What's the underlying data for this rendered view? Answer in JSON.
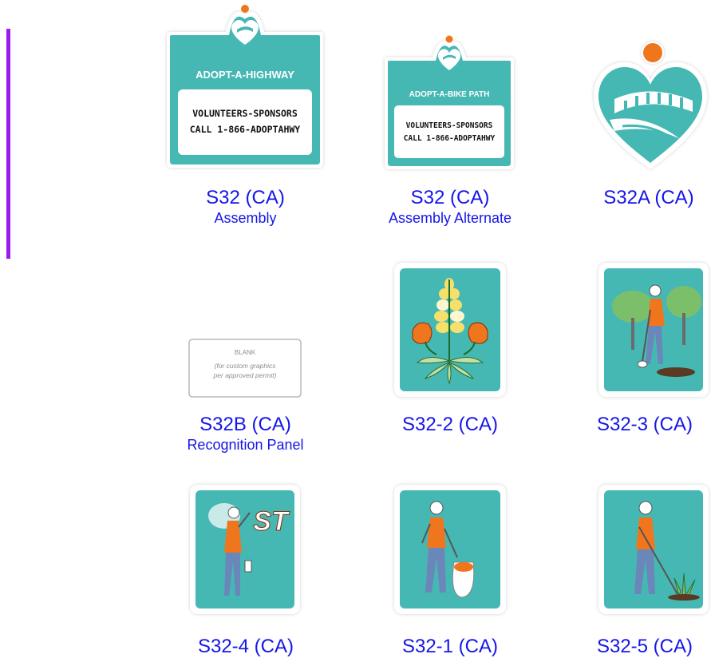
{
  "colors": {
    "teal": "#45b8b4",
    "orange": "#f0761e",
    "link_blue": "#1515ea",
    "purple_bar": "#9b1ee8"
  },
  "signs": [
    {
      "code": "S32 (CA)",
      "subtitle": "Assembly",
      "header": "ADOPT-A-HIGHWAY",
      "panel_line1": "VOLUNTEERS-SPONSORS",
      "panel_line2": "CALL 1-866-ADOPTAHWY"
    },
    {
      "code": "S32 (CA)",
      "subtitle": "Assembly Alternate",
      "header": "ADOPT-A-BIKE PATH",
      "panel_line1": "VOLUNTEERS-SPONSORS",
      "panel_line2": "CALL 1-866-ADOPTAHWY"
    },
    {
      "code": "S32A (CA)",
      "subtitle": ""
    },
    {
      "code": "S32B (CA)",
      "subtitle": "Recognition Panel",
      "blank_line1": "BLANK",
      "blank_line2": "(for custom graphics",
      "blank_line3": "per approved permit)"
    },
    {
      "code": "S32-2 (CA)",
      "subtitle": ""
    },
    {
      "code": "S32-3 (CA)",
      "subtitle": ""
    },
    {
      "code": "S32-4 (CA)",
      "subtitle": "",
      "graffiti": "ST"
    },
    {
      "code": "S32-1 (CA)",
      "subtitle": ""
    },
    {
      "code": "S32-5 (CA)",
      "subtitle": ""
    }
  ]
}
